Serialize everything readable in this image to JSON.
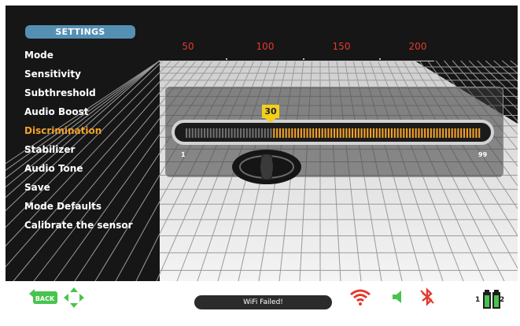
{
  "header": {
    "title": "SETTINGS"
  },
  "menu": {
    "items": [
      {
        "label": "Mode"
      },
      {
        "label": "Sensitivity"
      },
      {
        "label": "Subthreshold"
      },
      {
        "label": "Audio Boost"
      },
      {
        "label": "Discrimination"
      },
      {
        "label": "Stabilizer"
      },
      {
        "label": "Audio Tone"
      },
      {
        "label": "Save"
      },
      {
        "label": "Mode Defaults"
      },
      {
        "label": "Calibrate the sensor"
      }
    ],
    "active_index": 4
  },
  "scale": {
    "labels": [
      "50",
      "100",
      "150",
      "200"
    ]
  },
  "discrimination": {
    "value": "30",
    "min_label": "1",
    "max_label": "99",
    "min": 1,
    "max": 99
  },
  "status": {
    "wifi": "WiFi Failed!"
  },
  "buttons": {
    "back_label": "BACK"
  },
  "battery": {
    "slot1": "1",
    "slot2": "2"
  },
  "colors": {
    "accent": "#f2a22a",
    "scale": "#e83a2c",
    "tab": "#5590b3",
    "pointer": "#f2cf1d",
    "green": "#49c34f",
    "alert": "#e23a2e"
  }
}
